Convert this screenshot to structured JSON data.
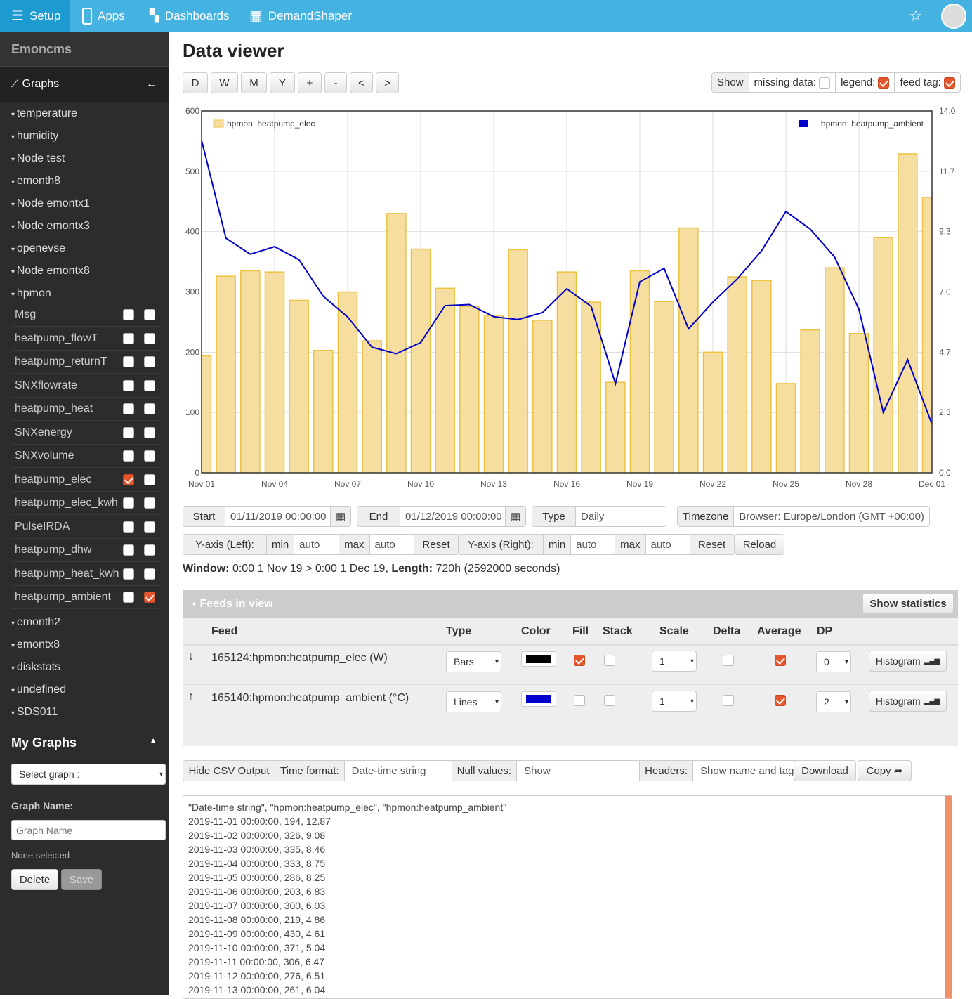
{
  "topnav": {
    "setup": "Setup",
    "apps": "Apps",
    "dashboards": "Dashboards",
    "demandshaper": "DemandShaper"
  },
  "sidebar": {
    "brand": "Emoncms",
    "graphs": "Graphs",
    "categories_top": [
      "temperature",
      "humidity",
      "Node test",
      "emonth8",
      "Node emontx1",
      "Node emontx3",
      "openevse",
      "Node emontx8",
      "hpmon"
    ],
    "feeds": [
      {
        "name": "Msg",
        "left": false,
        "right": false
      },
      {
        "name": "heatpump_flowT",
        "left": false,
        "right": false
      },
      {
        "name": "heatpump_returnT",
        "left": false,
        "right": false
      },
      {
        "name": "SNXflowrate",
        "left": false,
        "right": false
      },
      {
        "name": "heatpump_heat",
        "left": false,
        "right": false
      },
      {
        "name": "SNXenergy",
        "left": false,
        "right": false
      },
      {
        "name": "SNXvolume",
        "left": false,
        "right": false
      },
      {
        "name": "heatpump_elec",
        "left": true,
        "right": false
      },
      {
        "name": "heatpump_elec_kwh",
        "left": false,
        "right": false
      },
      {
        "name": "PulseIRDA",
        "left": false,
        "right": false
      },
      {
        "name": "heatpump_dhw",
        "left": false,
        "right": false
      },
      {
        "name": "heatpump_heat_kwh",
        "left": false,
        "right": false
      },
      {
        "name": "heatpump_ambient",
        "left": false,
        "right": true
      }
    ],
    "categories_bottom": [
      "emonth2",
      "emontx8",
      "diskstats",
      "undefined",
      "SDS011"
    ],
    "my_graphs": "My Graphs",
    "select_graph": "Select graph :",
    "graph_name_label": "Graph Name:",
    "graph_name_placeholder": "Graph Name",
    "none_selected": "None selected",
    "delete": "Delete",
    "save": "Save"
  },
  "page": {
    "title": "Data viewer"
  },
  "toolbar": {
    "buttons": [
      "D",
      "W",
      "M",
      "Y",
      "+",
      "-",
      "<",
      ">"
    ],
    "show": "Show",
    "missing_data": "missing data:",
    "missing_data_checked": false,
    "legend": "legend:",
    "legend_checked": true,
    "feed_tag": "feed tag:",
    "feed_tag_checked": true
  },
  "controls": {
    "start_label": "Start",
    "start": "01/11/2019 00:00:00",
    "end_label": "End",
    "end": "01/12/2019 00:00:00",
    "type_label": "Type",
    "type": "Daily",
    "timezone_label": "Timezone",
    "timezone": "Browser: Europe/London (GMT +00:00)",
    "yleft_label": "Y-axis (Left):",
    "yright_label": "Y-axis (Right):",
    "min": "min",
    "max": "max",
    "auto": "auto",
    "reset": "Reset",
    "reload": "Reload"
  },
  "window": {
    "label": "Window:",
    "range": "0:00 1 Nov 19 > 0:00 1 Dec 19,",
    "length_label": "Length:",
    "length": "720h (2592000 seconds)"
  },
  "feeds_panel": {
    "title": "Feeds in view",
    "show_statistics": "Show statistics",
    "headers": [
      "Feed",
      "Type",
      "Color",
      "Fill",
      "Stack",
      "Scale",
      "Delta",
      "Average",
      "DP"
    ],
    "rows": [
      {
        "feed": "165124:hpmon:heatpump_elec (W)",
        "axis": "down",
        "type": "Bars",
        "color": "#000000",
        "fill": true,
        "stack": false,
        "scale": "1",
        "delta": false,
        "average": true,
        "dp": "0",
        "histogram": "Histogram"
      },
      {
        "feed": "165140:hpmon:heatpump_ambient (°C)",
        "axis": "up",
        "type": "Lines",
        "color": "#0000cc",
        "fill": false,
        "stack": false,
        "scale": "1",
        "delta": false,
        "average": true,
        "dp": "2",
        "histogram": "Histogram"
      }
    ]
  },
  "csv": {
    "hide": "Hide CSV Output",
    "time_format_label": "Time format:",
    "time_format": "Date-time string",
    "null_label": "Null values:",
    "null": "Show",
    "headers_label": "Headers:",
    "headers": "Show name and tag",
    "download": "Download",
    "copy": "Copy",
    "lines": [
      "\"Date-time string\", \"hpmon:heatpump_elec\", \"hpmon:heatpump_ambient\"",
      "2019-11-01 00:00:00, 194, 12.87",
      "2019-11-02 00:00:00, 326, 9.08",
      "2019-11-03 00:00:00, 335, 8.46",
      "2019-11-04 00:00:00, 333, 8.75",
      "2019-11-05 00:00:00, 286, 8.25",
      "2019-11-06 00:00:00, 203, 6.83",
      "2019-11-07 00:00:00, 300, 6.03",
      "2019-11-08 00:00:00, 219, 4.86",
      "2019-11-09 00:00:00, 430, 4.61",
      "2019-11-10 00:00:00, 371, 5.04",
      "2019-11-11 00:00:00, 306, 6.47",
      "2019-11-12 00:00:00, 276, 6.51",
      "2019-11-13 00:00:00, 261, 6.04"
    ]
  },
  "chart_data": {
    "type": "bar+line",
    "x_ticks": [
      "Nov 01",
      "Nov 04",
      "Nov 07",
      "Nov 10",
      "Nov 13",
      "Nov 16",
      "Nov 19",
      "Nov 22",
      "Nov 25",
      "Nov 28",
      "Dec 01"
    ],
    "y_left_ticks": [
      "0",
      "100",
      "200",
      "300",
      "400",
      "500",
      "600"
    ],
    "ylim_left": [
      0,
      600
    ],
    "y_right_ticks": [
      "0.0",
      "2.3",
      "4.7",
      "7.0",
      "9.3",
      "11.7",
      "14.0"
    ],
    "ylim_right": [
      0,
      14
    ],
    "grid": true,
    "series": [
      {
        "name": "hpmon: heatpump_elec",
        "type": "bar",
        "axis": "left",
        "color": "#edc240",
        "legend": "top-left",
        "values": [
          194,
          326,
          335,
          333,
          286,
          203,
          300,
          219,
          430,
          371,
          306,
          276,
          261,
          370,
          253,
          333,
          283,
          150,
          335,
          284,
          406,
          200,
          325,
          319,
          148,
          237,
          340,
          231,
          390,
          529,
          457
        ]
      },
      {
        "name": "hpmon: heatpump_ambient",
        "type": "line",
        "axis": "right",
        "color": "#0000cc",
        "legend": "top-right",
        "values": [
          12.87,
          9.08,
          8.46,
          8.75,
          8.25,
          6.83,
          6.03,
          4.86,
          4.61,
          5.04,
          6.47,
          6.51,
          6.04,
          5.93,
          6.2,
          7.12,
          6.44,
          3.45,
          7.39,
          7.91,
          5.57,
          6.6,
          7.5,
          8.59,
          10.11,
          9.43,
          8.35,
          6.33,
          2.34,
          4.38,
          1.88
        ]
      }
    ]
  }
}
